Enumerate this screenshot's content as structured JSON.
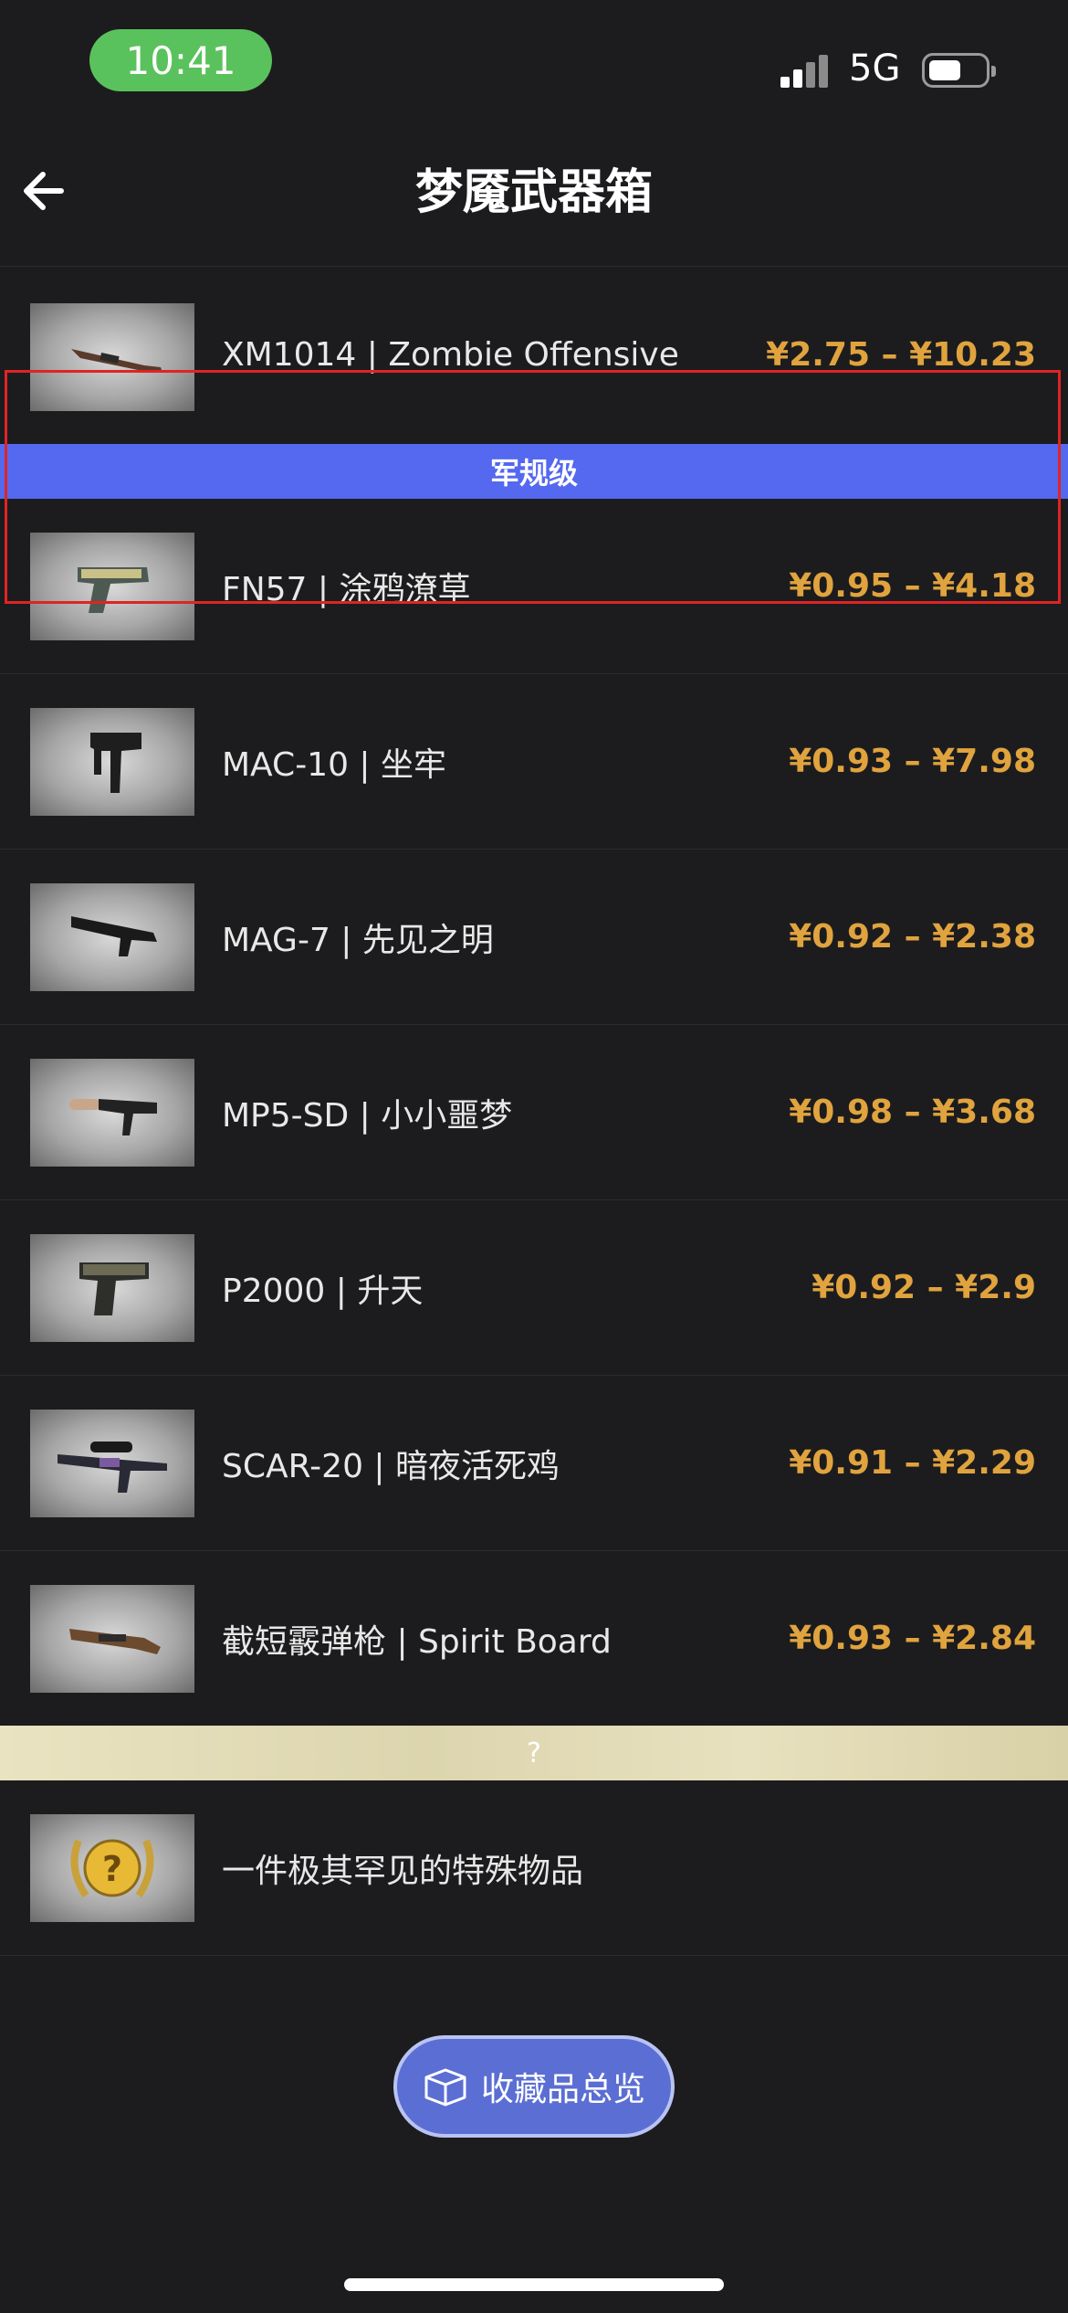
{
  "status_bar": {
    "time": "10:41",
    "network": "5G"
  },
  "nav": {
    "title": "梦魇武器箱"
  },
  "grade_label": "军规级",
  "items": [
    {
      "name": "XM1014 | Zombie Offensive",
      "price": "¥2.75 – ¥10.23",
      "icon": "shotgun-icon"
    },
    {
      "name": "FN57 | 涂鸦潦草",
      "price": "¥0.95 – ¥4.18",
      "icon": "pistol-icon"
    },
    {
      "name": "MAC-10 | 坐牢",
      "price": "¥0.93 – ¥7.98",
      "icon": "smg-icon"
    },
    {
      "name": "MAG-7 | 先见之明",
      "price": "¥0.92 – ¥2.38",
      "icon": "shotgun-icon"
    },
    {
      "name": "MP5-SD | 小小噩梦",
      "price": "¥0.98 – ¥3.68",
      "icon": "smg-icon"
    },
    {
      "name": "P2000 | 升天",
      "price": "¥0.92 – ¥2.9",
      "icon": "pistol-icon"
    },
    {
      "name": "SCAR-20 | 暗夜活死鸡",
      "price": "¥0.91 – ¥2.29",
      "icon": "sniper-rifle-icon"
    },
    {
      "name": "截短霰弹枪 | Spirit Board",
      "price": "¥0.93 – ¥2.84",
      "icon": "shotgun-icon"
    }
  ],
  "rare": {
    "label": "?",
    "item_name": "一件极其罕见的特殊物品",
    "icon": "rare-special-item-icon"
  },
  "summary_button": {
    "label": "收藏品总览",
    "icon": "box-icon"
  },
  "colors": {
    "grade": "#5468f0",
    "price": "#e0a33e",
    "button": "#5b6ed4",
    "highlight": "#e02424"
  }
}
